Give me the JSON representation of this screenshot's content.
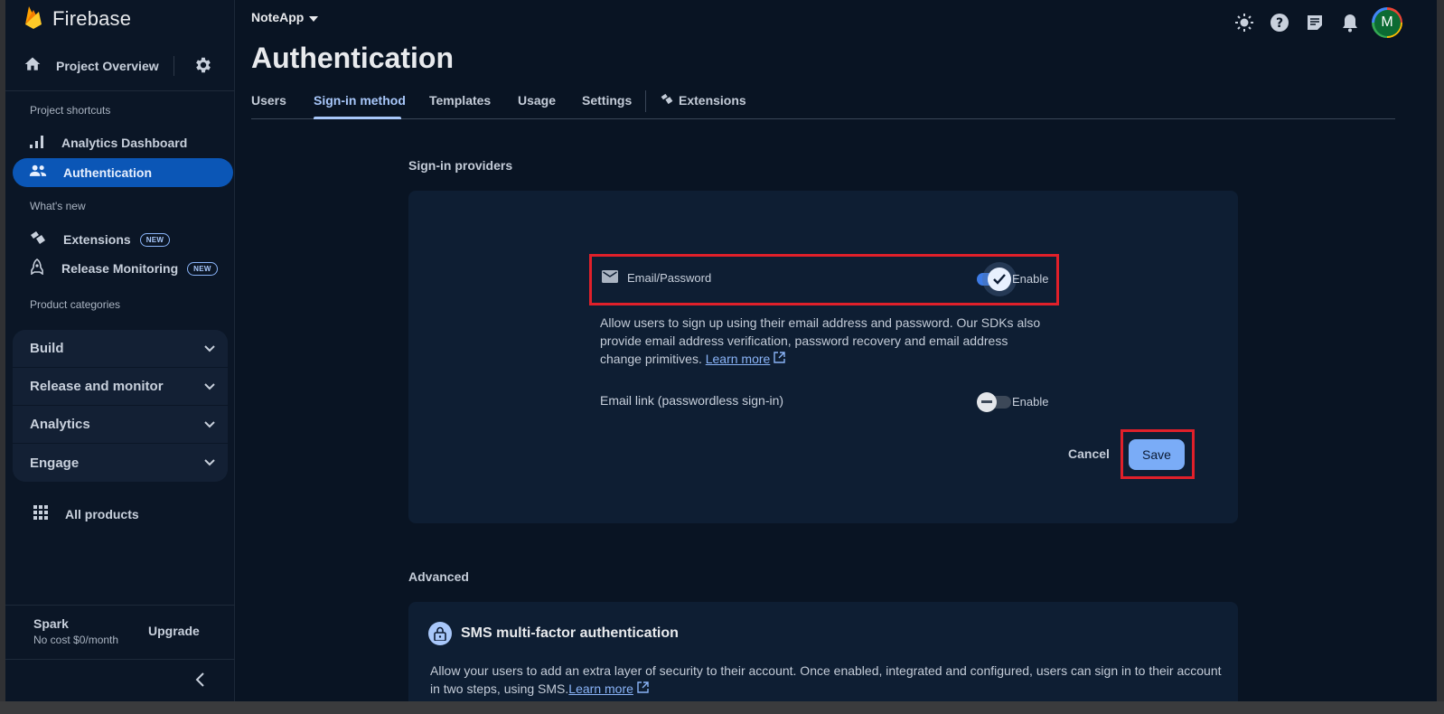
{
  "app": {
    "brand": "Firebase",
    "project": "NoteApp"
  },
  "sidebar": {
    "overview": "Project Overview",
    "shortcuts_label": "Project shortcuts",
    "shortcuts": [
      {
        "label": "Analytics Dashboard"
      },
      {
        "label": "Authentication"
      }
    ],
    "whats_new_label": "What's new",
    "whats_new": [
      {
        "label": "Extensions",
        "badge": "NEW"
      },
      {
        "label": "Release Monitoring",
        "badge": "NEW"
      }
    ],
    "categories_label": "Product categories",
    "categories": [
      "Build",
      "Release and monitor",
      "Analytics",
      "Engage"
    ],
    "all_products": "All products",
    "plan": {
      "name": "Spark",
      "cost": "No cost $0/month",
      "upgrade": "Upgrade"
    }
  },
  "header": {
    "avatar_letter": "M"
  },
  "page": {
    "title": "Authentication",
    "tabs": [
      "Users",
      "Sign-in method",
      "Templates",
      "Usage",
      "Settings",
      "Extensions"
    ],
    "active_tab": "Sign-in method"
  },
  "providers": {
    "heading": "Sign-in providers",
    "email_password": {
      "label": "Email/Password",
      "enable_label": "Enable",
      "enabled": true
    },
    "description": "Allow users to sign up using their email address and password. Our SDKs also provide email address verification, password recovery and email address change primitives.",
    "learn_more": "Learn more",
    "email_link": {
      "label": "Email link (passwordless sign-in)",
      "enable_label": "Enable",
      "enabled": false
    },
    "cancel": "Cancel",
    "save": "Save"
  },
  "advanced": {
    "heading": "Advanced",
    "sms": {
      "title": "SMS multi-factor authentication",
      "description": "Allow your users to add an extra layer of security to their account. Once enabled, integrated and configured, users can sign in to their account in two steps, using SMS.",
      "learn_more": "Learn more"
    }
  },
  "colors": {
    "accent": "#a8c7fa",
    "active_nav": "#0b56b6",
    "highlight": "#e0202a",
    "save_button": "#7aacf7"
  }
}
